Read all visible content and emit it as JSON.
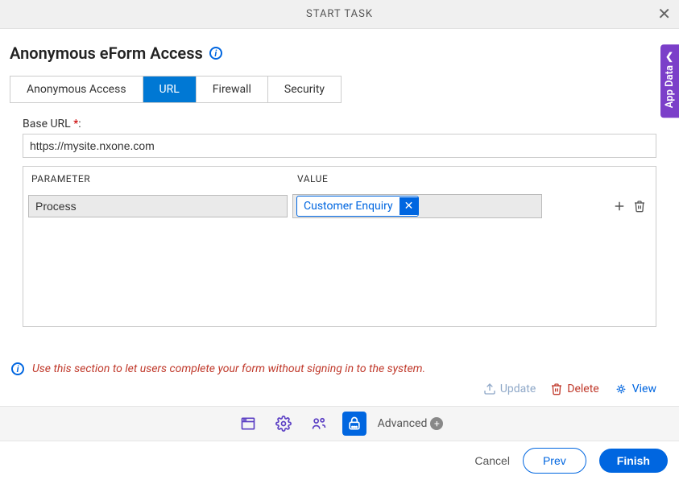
{
  "header": {
    "title": "START TASK"
  },
  "page": {
    "title": "Anonymous eForm Access"
  },
  "tabs": [
    {
      "label": "Anonymous Access",
      "active": false
    },
    {
      "label": "URL",
      "active": true
    },
    {
      "label": "Firewall",
      "active": false
    },
    {
      "label": "Security",
      "active": false
    }
  ],
  "url": {
    "label": "Base URL ",
    "required": "*",
    "colon": ":",
    "value": "https://mysite.nxone.com"
  },
  "param_table": {
    "header_param": "PARAMETER",
    "header_value": "VALUE",
    "rows": [
      {
        "name": "Process",
        "value_label": "Customer Enquiry"
      }
    ]
  },
  "hint": "Use this section to let users complete your form without signing in to the system.",
  "actions": {
    "update": "Update",
    "delete": "Delete",
    "view": "View"
  },
  "footer": {
    "advanced": "Advanced"
  },
  "buttons": {
    "cancel": "Cancel",
    "prev": "Prev",
    "finish": "Finish"
  },
  "side_tab": "App Data"
}
